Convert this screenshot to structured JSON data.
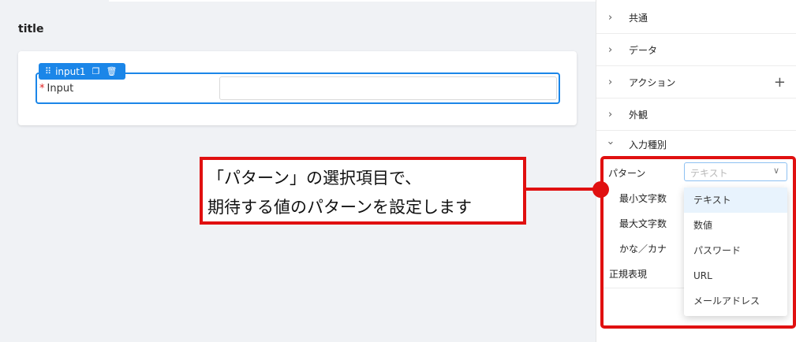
{
  "canvas": {
    "title": "title",
    "component_tag": "input1",
    "field": {
      "required_mark": "*",
      "label": "Input"
    }
  },
  "panel": {
    "sections": [
      {
        "label": "共通",
        "expanded": false
      },
      {
        "label": "データ",
        "expanded": false
      },
      {
        "label": "アクション",
        "expanded": false,
        "has_add": true
      },
      {
        "label": "外観",
        "expanded": false
      },
      {
        "label": "入力種別",
        "expanded": true
      }
    ],
    "props": {
      "pattern_label": "パターン",
      "pattern_placeholder": "テキスト",
      "min_label": "最小文字数",
      "max_label": "最大文字数",
      "kana_label": "かな／カナ",
      "regex_label": "正規表現"
    },
    "dropdown_options": [
      "テキスト",
      "数値",
      "パスワード",
      "URL",
      "メールアドレス"
    ],
    "selected_option": "テキスト"
  },
  "annotation": {
    "line1": "「パターン」の選択項目で、",
    "line2": "期待する値のパターンを設定します",
    "color": "#e01010"
  },
  "colors": {
    "accent": "#1b86e8",
    "annotation": "#e01010"
  }
}
